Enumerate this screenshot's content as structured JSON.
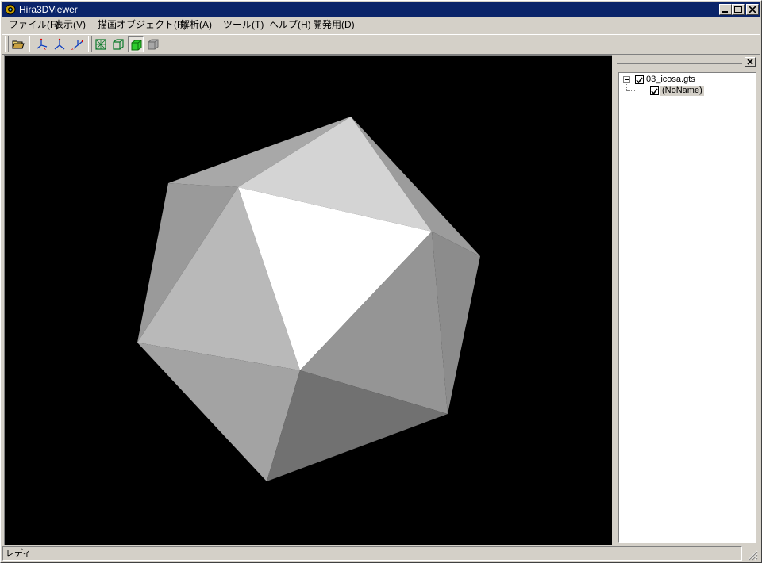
{
  "window": {
    "title": "Hira3DViewer"
  },
  "menubar": {
    "items": [
      {
        "label": "ファイル(F)"
      },
      {
        "label": "表示(V)"
      },
      {
        "label": "描画オブジェクト(R)"
      },
      {
        "label": "解析(A)"
      },
      {
        "label": "ツール(T)"
      },
      {
        "label": "ヘルプ(H)"
      },
      {
        "label": "開発用(D)"
      }
    ]
  },
  "toolbar": {
    "icons": [
      "open-folder-icon",
      "axis-x-view-icon",
      "axis-y-view-icon",
      "axis-z-view-icon",
      "wireframe-icon",
      "edges-icon",
      "solid-shading-icon",
      "disabled-shading-icon"
    ]
  },
  "tree": {
    "root": {
      "label": "03_icosa.gts",
      "checked": true
    },
    "child": {
      "label": "(NoName)",
      "checked": true
    }
  },
  "status": {
    "text": "レディ"
  },
  "colors": {
    "title_bar": "#0a246a",
    "face": "#d4d0c8",
    "viewport_bg": "#000000",
    "selection_gray": "#d4d0c8"
  }
}
